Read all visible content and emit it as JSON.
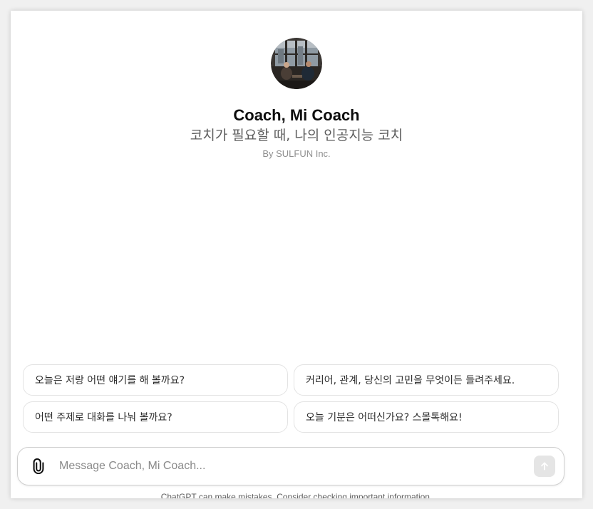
{
  "gpt": {
    "name": "Coach, Mi Coach",
    "description": "코치가 필요할 때, 나의 인공지능 코치",
    "author": "By SULFUN Inc.",
    "avatar": "coach-avatar-photo"
  },
  "conversation_starters": [
    {
      "label": "오늘은 저랑 어떤 얘기를 해 볼까요?"
    },
    {
      "label": "커리어, 관계, 당신의 고민을 무엇이든 들려주세요."
    },
    {
      "label": "어떤 주제로 대화를 나눠 볼까요?"
    },
    {
      "label": "오늘 기분은 어떠신가요? 스몰톡해요!"
    }
  ],
  "composer": {
    "placeholder": "Message Coach, Mi Coach...",
    "value": "",
    "attach_icon": "paperclip-icon",
    "send_icon": "arrow-up-icon"
  },
  "footer": {
    "disclaimer": "ChatGPT can make mistakes. Consider checking important information."
  },
  "colors": {
    "background": "#ffffff",
    "border": "#e3e3e3",
    "send_disabled": "#e5e5e5"
  }
}
